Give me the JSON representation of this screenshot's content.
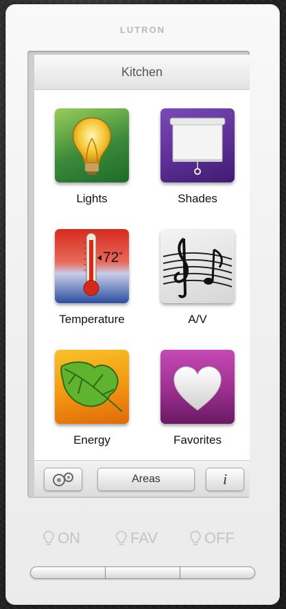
{
  "device": {
    "brand": "LUTRON"
  },
  "screen": {
    "title": "Kitchen",
    "tiles": [
      {
        "label": "Lights",
        "icon": "light-bulb-icon"
      },
      {
        "label": "Shades",
        "icon": "shade-icon"
      },
      {
        "label": "Temperature",
        "icon": "thermometer-icon",
        "temp_text": "72",
        "temp_unit": "°"
      },
      {
        "label": "A/V",
        "icon": "music-notes-icon"
      },
      {
        "label": "Energy",
        "icon": "leaf-icon"
      },
      {
        "label": "Favorites",
        "icon": "heart-icon"
      }
    ],
    "toolbar": {
      "settings_icon": "gears-icon",
      "areas_label": "Areas",
      "info_label": "i"
    }
  },
  "hardware_buttons": {
    "on_label": "ON",
    "fav_label": "FAV",
    "off_label": "OFF"
  },
  "colors": {
    "lights": "#3a8a3a",
    "shades": "#5a2d91",
    "temperature_hot": "#d62b1e",
    "temperature_cold": "#2c4ea0",
    "energy": "#f39a12",
    "favorites": "#9b2f8f"
  }
}
